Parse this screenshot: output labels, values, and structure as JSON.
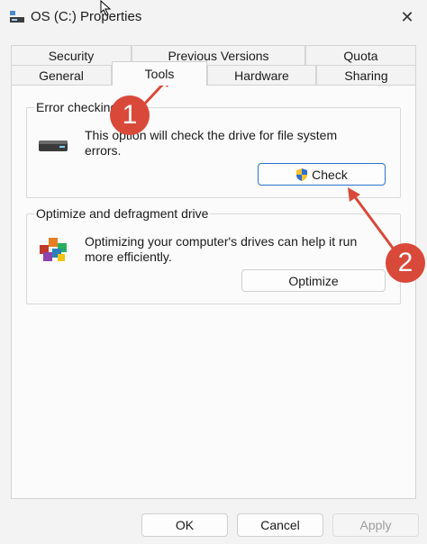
{
  "window": {
    "title": "OS (C:) Properties",
    "close_glyph": "✕"
  },
  "tabs": {
    "row1": [
      "Security",
      "Previous Versions",
      "Quota"
    ],
    "row2": [
      "General",
      "Tools",
      "Hardware",
      "Sharing"
    ],
    "active": "Tools"
  },
  "error_checking": {
    "group_title": "Error checking",
    "description": "This option will check the drive for file system errors.",
    "button_label": "Check",
    "icon": "drive-icon",
    "button_icon": "shield-icon"
  },
  "optimize": {
    "group_title": "Optimize and defragment drive",
    "description": "Optimizing your computer's drives can help it run more efficiently.",
    "button_label": "Optimize",
    "icon": "defrag-icon"
  },
  "dialog_buttons": {
    "ok": "OK",
    "cancel": "Cancel",
    "apply": "Apply"
  },
  "annotations": {
    "badge1": "1",
    "badge2": "2",
    "color": "#d9493a"
  }
}
